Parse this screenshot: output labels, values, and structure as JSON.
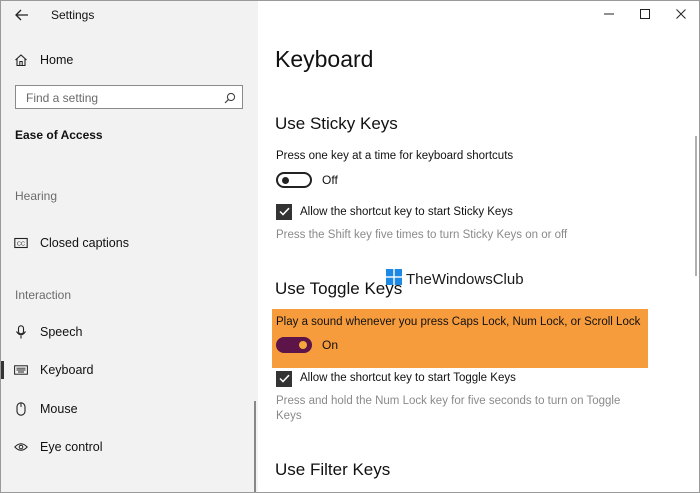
{
  "window": {
    "title": "Settings"
  },
  "sidebar": {
    "home_label": "Home",
    "search_placeholder": "Find a setting",
    "category": "Ease of Access",
    "groups": {
      "hearing": "Hearing",
      "interaction": "Interaction"
    },
    "items": {
      "closed_captions": "Closed captions",
      "speech": "Speech",
      "keyboard": "Keyboard",
      "mouse": "Mouse",
      "eye_control": "Eye control"
    }
  },
  "main": {
    "page_title": "Keyboard",
    "sticky": {
      "heading": "Use Sticky Keys",
      "description": "Press one key at a time for keyboard shortcuts",
      "toggle_state": "Off",
      "shortcut_label": "Allow the shortcut key to start Sticky Keys",
      "hint": "Press the Shift key five times to turn Sticky Keys on or off"
    },
    "toggle_keys": {
      "heading": "Use Toggle Keys",
      "description": "Play a sound whenever you press Caps Lock, Num Lock, or Scroll Lock",
      "toggle_state": "On",
      "shortcut_label": "Allow the shortcut key to start Toggle Keys",
      "hint": "Press and hold the Num Lock key for five seconds to turn on Toggle Keys"
    },
    "filter_keys": {
      "heading": "Use Filter Keys"
    }
  },
  "watermark": {
    "text": "TheWindowsClub"
  },
  "colors": {
    "toggle_on": "#5d1449",
    "highlight": "#f79c3d",
    "knob_on": "#f5a63a"
  }
}
